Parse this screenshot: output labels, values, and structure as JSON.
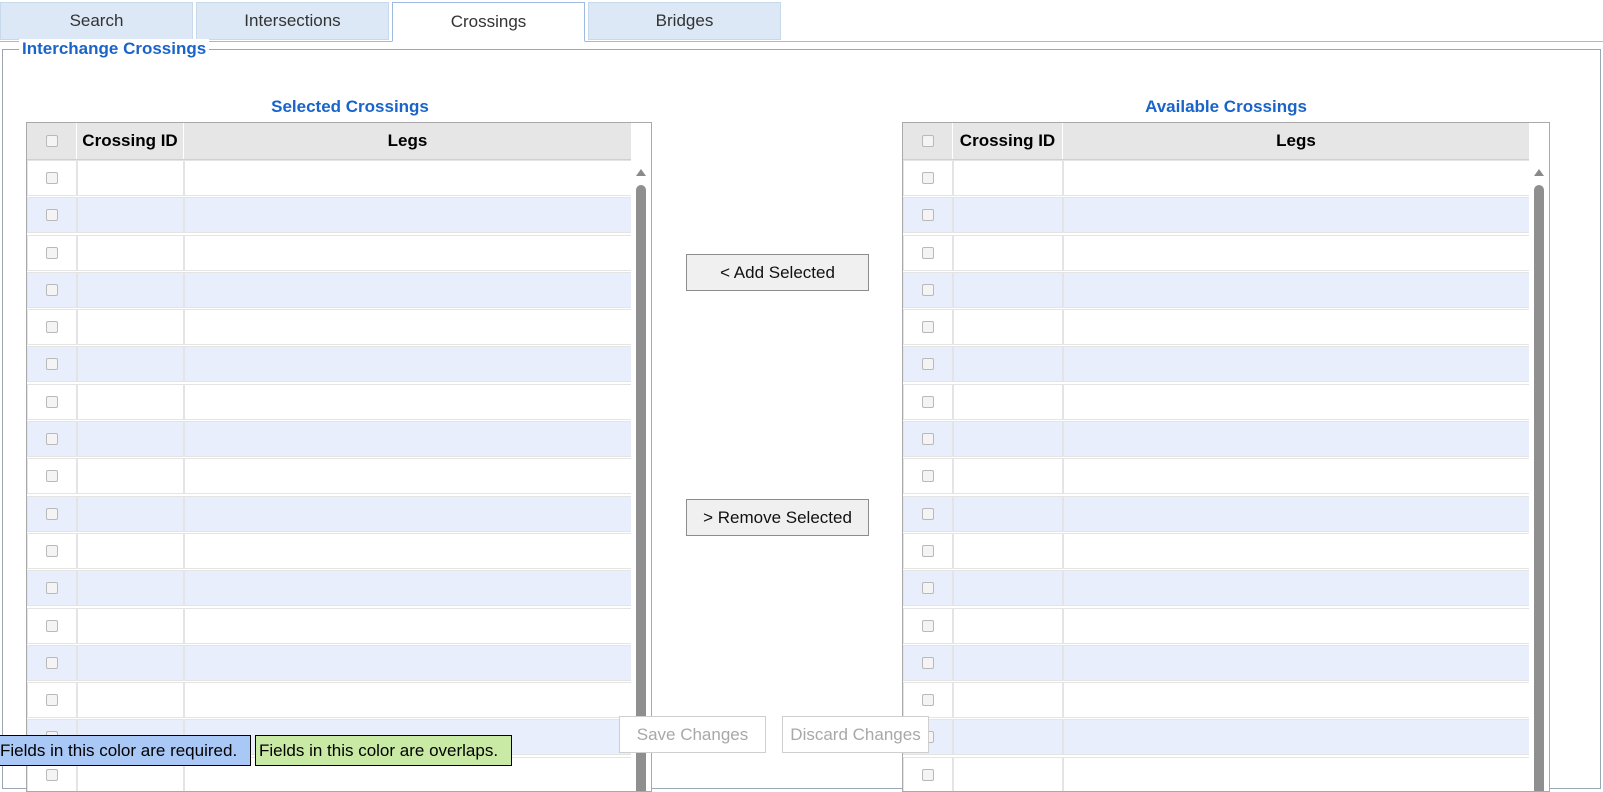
{
  "tabs": [
    {
      "label": "Search",
      "active": false
    },
    {
      "label": "Intersections",
      "active": false
    },
    {
      "label": "Crossings",
      "active": true
    },
    {
      "label": "Bridges",
      "active": false
    }
  ],
  "group": {
    "legend": "Interchange Crossings"
  },
  "selected_grid": {
    "title": "Selected Crossings",
    "columns": [
      "Crossing ID",
      "Legs"
    ]
  },
  "available_grid": {
    "title": "Available Crossings",
    "columns": [
      "Crossing ID",
      "Legs"
    ]
  },
  "actions": {
    "add_label": "< Add Selected",
    "remove_label": "> Remove Selected",
    "save_label": "Save Changes",
    "discard_label": "Discard Changes"
  },
  "legend": {
    "required_text": "Fields in this color are required.",
    "overlap_text": "Fields in this color are overlaps.",
    "required_color": "#a9c8f5",
    "overlap_color": "#c9eaa4"
  },
  "colors": {
    "accent": "#1a64c9",
    "tab_bg": "#dce8f5",
    "row_alt": "#e8eefb"
  }
}
